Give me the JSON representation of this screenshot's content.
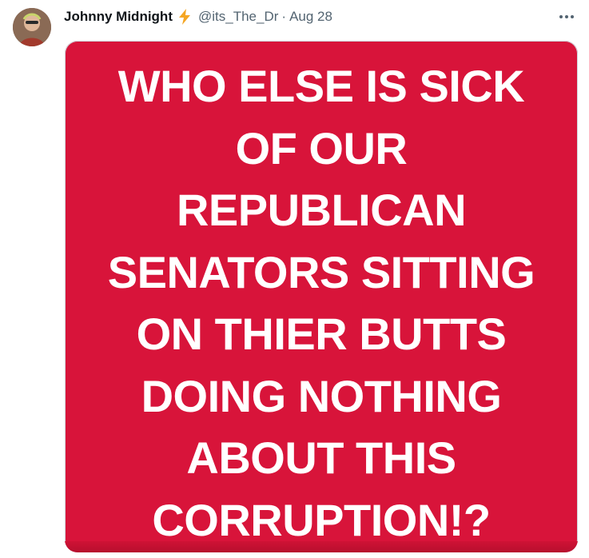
{
  "tweet": {
    "author": {
      "display_name": "Johnny Midnight",
      "handle": "@its_The_Dr",
      "badge_icon": "lightning-bolt-icon",
      "avatar_icon": "profile-photo"
    },
    "separator": "·",
    "date": "Aug 28",
    "more_icon": "more-horizontal-icon",
    "media": {
      "background_color": "#d8143a",
      "text_color": "#ffffff",
      "lines": [
        "WHO ELSE IS SICK",
        "OF OUR",
        "REPUBLICAN",
        "SENATORS SITTING",
        "ON THIER BUTTS",
        "DOING NOTHING",
        "ABOUT THIS",
        "CORRUPTION!?"
      ]
    }
  },
  "colors": {
    "name_text": "#0f1419",
    "secondary_text": "#536471",
    "bolt": "#f5a623"
  }
}
